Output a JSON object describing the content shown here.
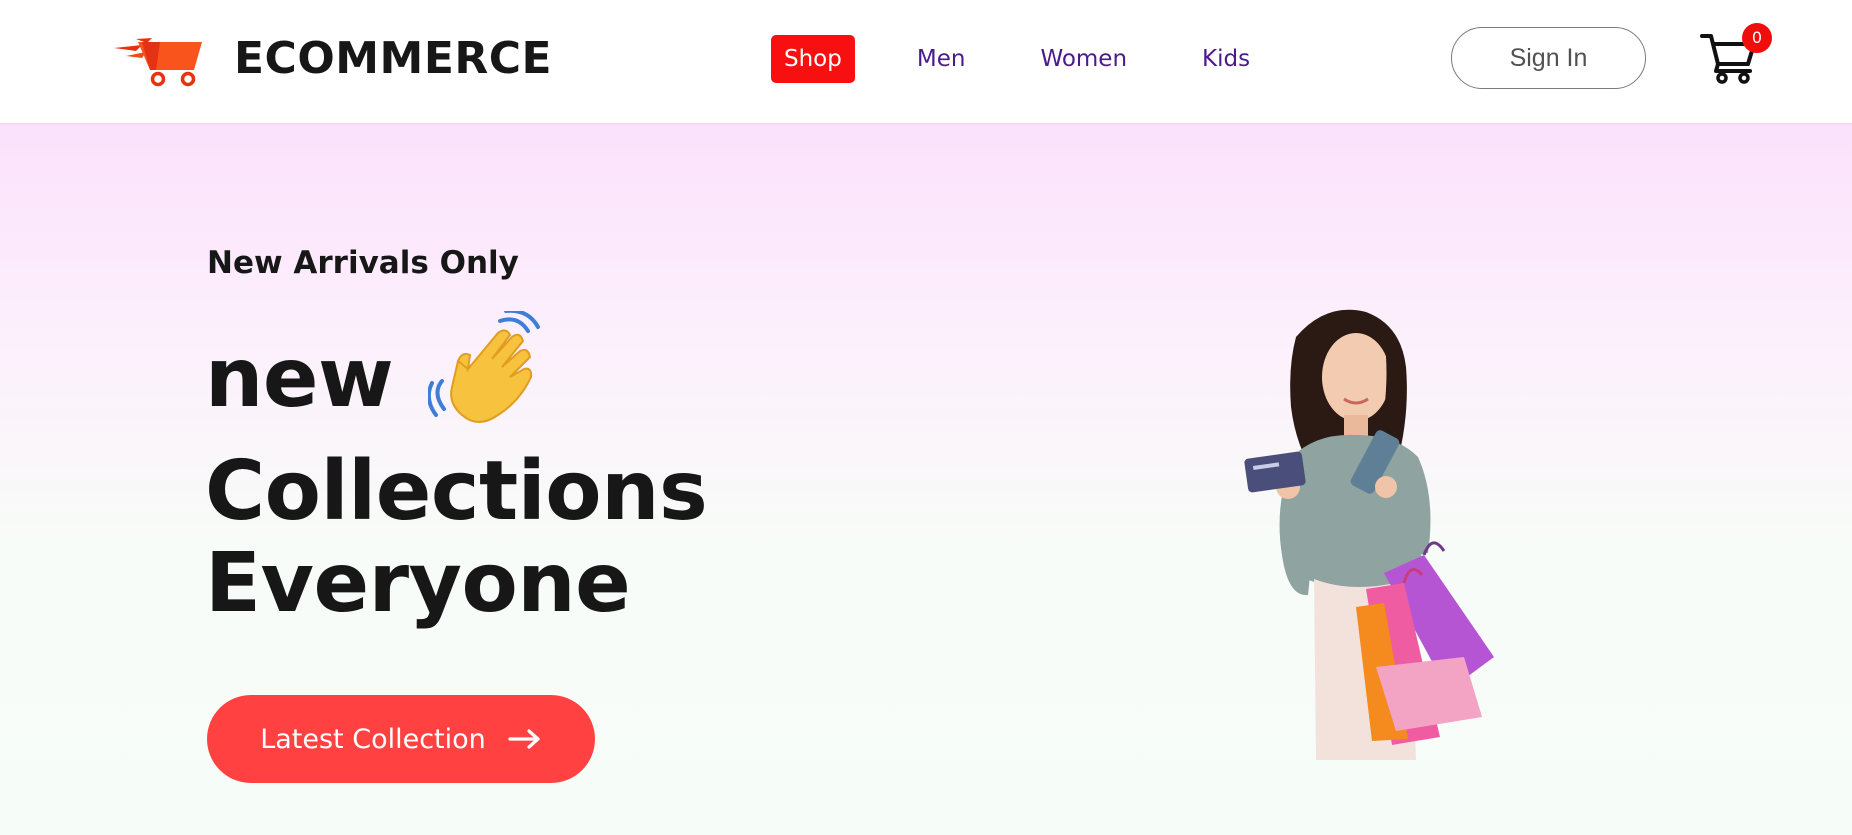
{
  "brand": {
    "name": "ECOMMERCE",
    "logo_icon": "shopping-cart-logo-icon",
    "accent_color": "#f84b1c"
  },
  "nav": {
    "items": [
      {
        "label": "Shop",
        "active": true
      },
      {
        "label": "Men",
        "active": false
      },
      {
        "label": "Women",
        "active": false
      },
      {
        "label": "Kids",
        "active": false
      }
    ],
    "active_color": "#f80f0f",
    "link_color": "#4c1a8c"
  },
  "header": {
    "signin_label": "Sign In",
    "cart_icon": "cart-icon",
    "cart_count": "0",
    "badge_color": "#f20d0d"
  },
  "hero": {
    "subtitle": "New Arrivals Only",
    "line1": "new",
    "line1_icon": "waving-hand-icon",
    "line2": "Collections",
    "line3": "Everyone",
    "cta_label": "Latest Collection",
    "cta_icon": "arrow-right-icon",
    "cta_color": "#ff4141",
    "image": "woman-with-shopping-bags-image"
  }
}
